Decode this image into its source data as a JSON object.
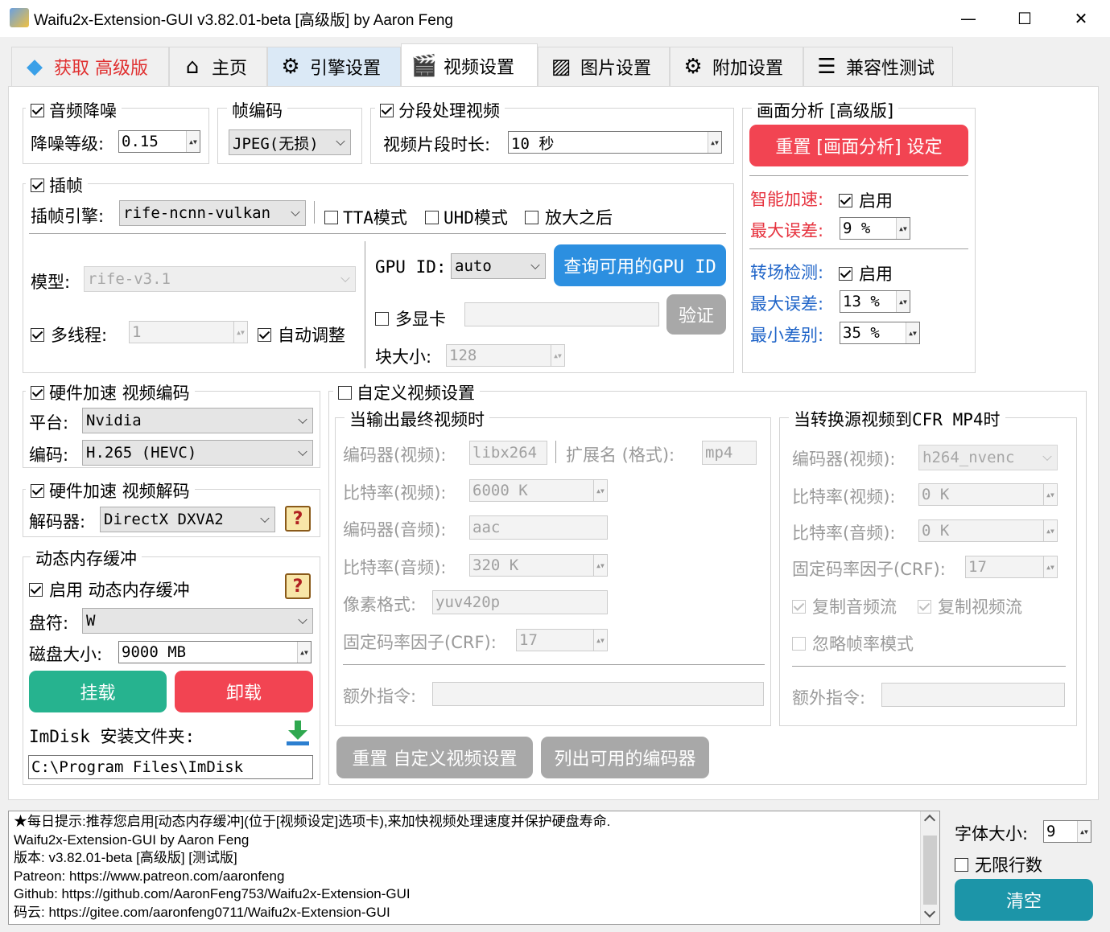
{
  "window": {
    "title": "Waifu2x-Extension-GUI v3.82.01-beta [高级版] by Aaron Feng",
    "min": "—",
    "max": "☐",
    "close": "✕"
  },
  "tabs": [
    {
      "label": "获取 高级版",
      "icon": "diamond-icon"
    },
    {
      "label": "主页",
      "icon": "home-icon"
    },
    {
      "label": "引擎设置",
      "icon": "engine-icon"
    },
    {
      "label": "视频设置",
      "icon": "clapper-icon"
    },
    {
      "label": "图片设置",
      "icon": "picture-icon"
    },
    {
      "label": "附加设置",
      "icon": "gear-icon"
    },
    {
      "label": "兼容性测试",
      "icon": "checklist-icon"
    }
  ],
  "audio_denoise": {
    "title": "音频降噪",
    "level_label": "降噪等级:",
    "level": "0.15"
  },
  "frame_codec": {
    "title": "帧编码",
    "value": "JPEG(无损)"
  },
  "segment": {
    "title": "分段处理视频",
    "length_label": "视频片段时长:",
    "length": "10 秒"
  },
  "scene": {
    "title": "画面分析 [高级版]",
    "reset_btn": "重置 [画面分析] 设定",
    "smart_label": "智能加速:",
    "enable": "启用",
    "max_err_label": "最大误差:",
    "smart_err": "9 %",
    "scene_label": "转场检测:",
    "scene_err": "13 %",
    "min_diff_label": "最小差别:",
    "min_diff": "35 %"
  },
  "interp": {
    "title": "插帧",
    "engine_label": "插帧引擎:",
    "engine": "rife-ncnn-vulkan",
    "tta": "TTA模式",
    "uhd": "UHD模式",
    "after": "放大之后",
    "model_label": "模型:",
    "model": "rife-v3.1",
    "multithread": "多线程:",
    "threads": "1",
    "auto_adjust": "自动调整",
    "gpu_label": "GPU ID:",
    "gpu": "auto",
    "query_btn": "查询可用的GPU ID",
    "multi_gpu": "多显卡",
    "verify_btn": "验证",
    "block_label": "块大小:",
    "block": "128"
  },
  "hw_enc": {
    "title": "硬件加速 视频编码",
    "platform_label": "平台:",
    "platform": "Nvidia",
    "codec_label": "编码:",
    "codec": "H.265 (HEVC)"
  },
  "hw_dec": {
    "title": "硬件加速 视频解码",
    "decoder_label": "解码器:",
    "decoder": "DirectX DXVA2"
  },
  "ramdisk": {
    "title": "动态内存缓冲",
    "enable": "启用 动态内存缓冲",
    "drive_label": "盘符:",
    "drive": "W",
    "size_label": "磁盘大小:",
    "size": "9000 MB",
    "mount": "挂载",
    "unmount": "卸载",
    "folder_label": "ImDisk 安装文件夹:",
    "folder": "C:\\Program Files\\ImDisk"
  },
  "custom": {
    "title": "自定义视频设置",
    "out_title": "当输出最终视频时",
    "venc_label": "编码器(视频):",
    "venc": "libx264",
    "ext_label": "扩展名 (格式):",
    "ext": "mp4",
    "vbit_label": "比特率(视频):",
    "vbit": "6000 K",
    "aenc_label": "编码器(音频):",
    "aenc": "aac",
    "abit_label": "比特率(音频):",
    "abit": "320 K",
    "pix_label": "像素格式:",
    "pix": "yuv420p",
    "crf_label": "固定码率因子(CRF):",
    "crf": "17",
    "extra_label": "额外指令:",
    "cfr_title": "当转换源视频到CFR MP4时",
    "cfr_venc": "h264_nvenc",
    "cfr_vbit": "0 K",
    "cfr_abit": "0 K",
    "cfr_crf": "17",
    "copy_audio": "复制音频流",
    "copy_video": "复制视频流",
    "ignore_fps": "忽略帧率模式",
    "reset_btn": "重置 自定义视频设置",
    "list_btn": "列出可用的编码器"
  },
  "log": {
    "lines": [
      "★每日提示:推荐您启用[动态内存缓冲](位于[视频设定]选项卡),来加快视频处理速度并保护硬盘寿命.",
      "Waifu2x-Extension-GUI by Aaron Feng",
      "版本: v3.82.01-beta [高级版] [测试版]",
      "Patreon: https://www.patreon.com/aaronfeng",
      "Github: https://github.com/AaronFeng753/Waifu2x-Extension-GUI",
      "码云: https://gitee.com/aaronfeng0711/Waifu2x-Extension-GUI"
    ]
  },
  "side": {
    "font_label": "字体大小:",
    "font_size": "9",
    "unlimited": "无限行数",
    "clear": "清空"
  },
  "colors": {
    "red": "#f24452",
    "blue": "#2c8fe0",
    "green": "#26b38f",
    "grey": "#a8a8a8",
    "teal": "#1c95a8"
  }
}
